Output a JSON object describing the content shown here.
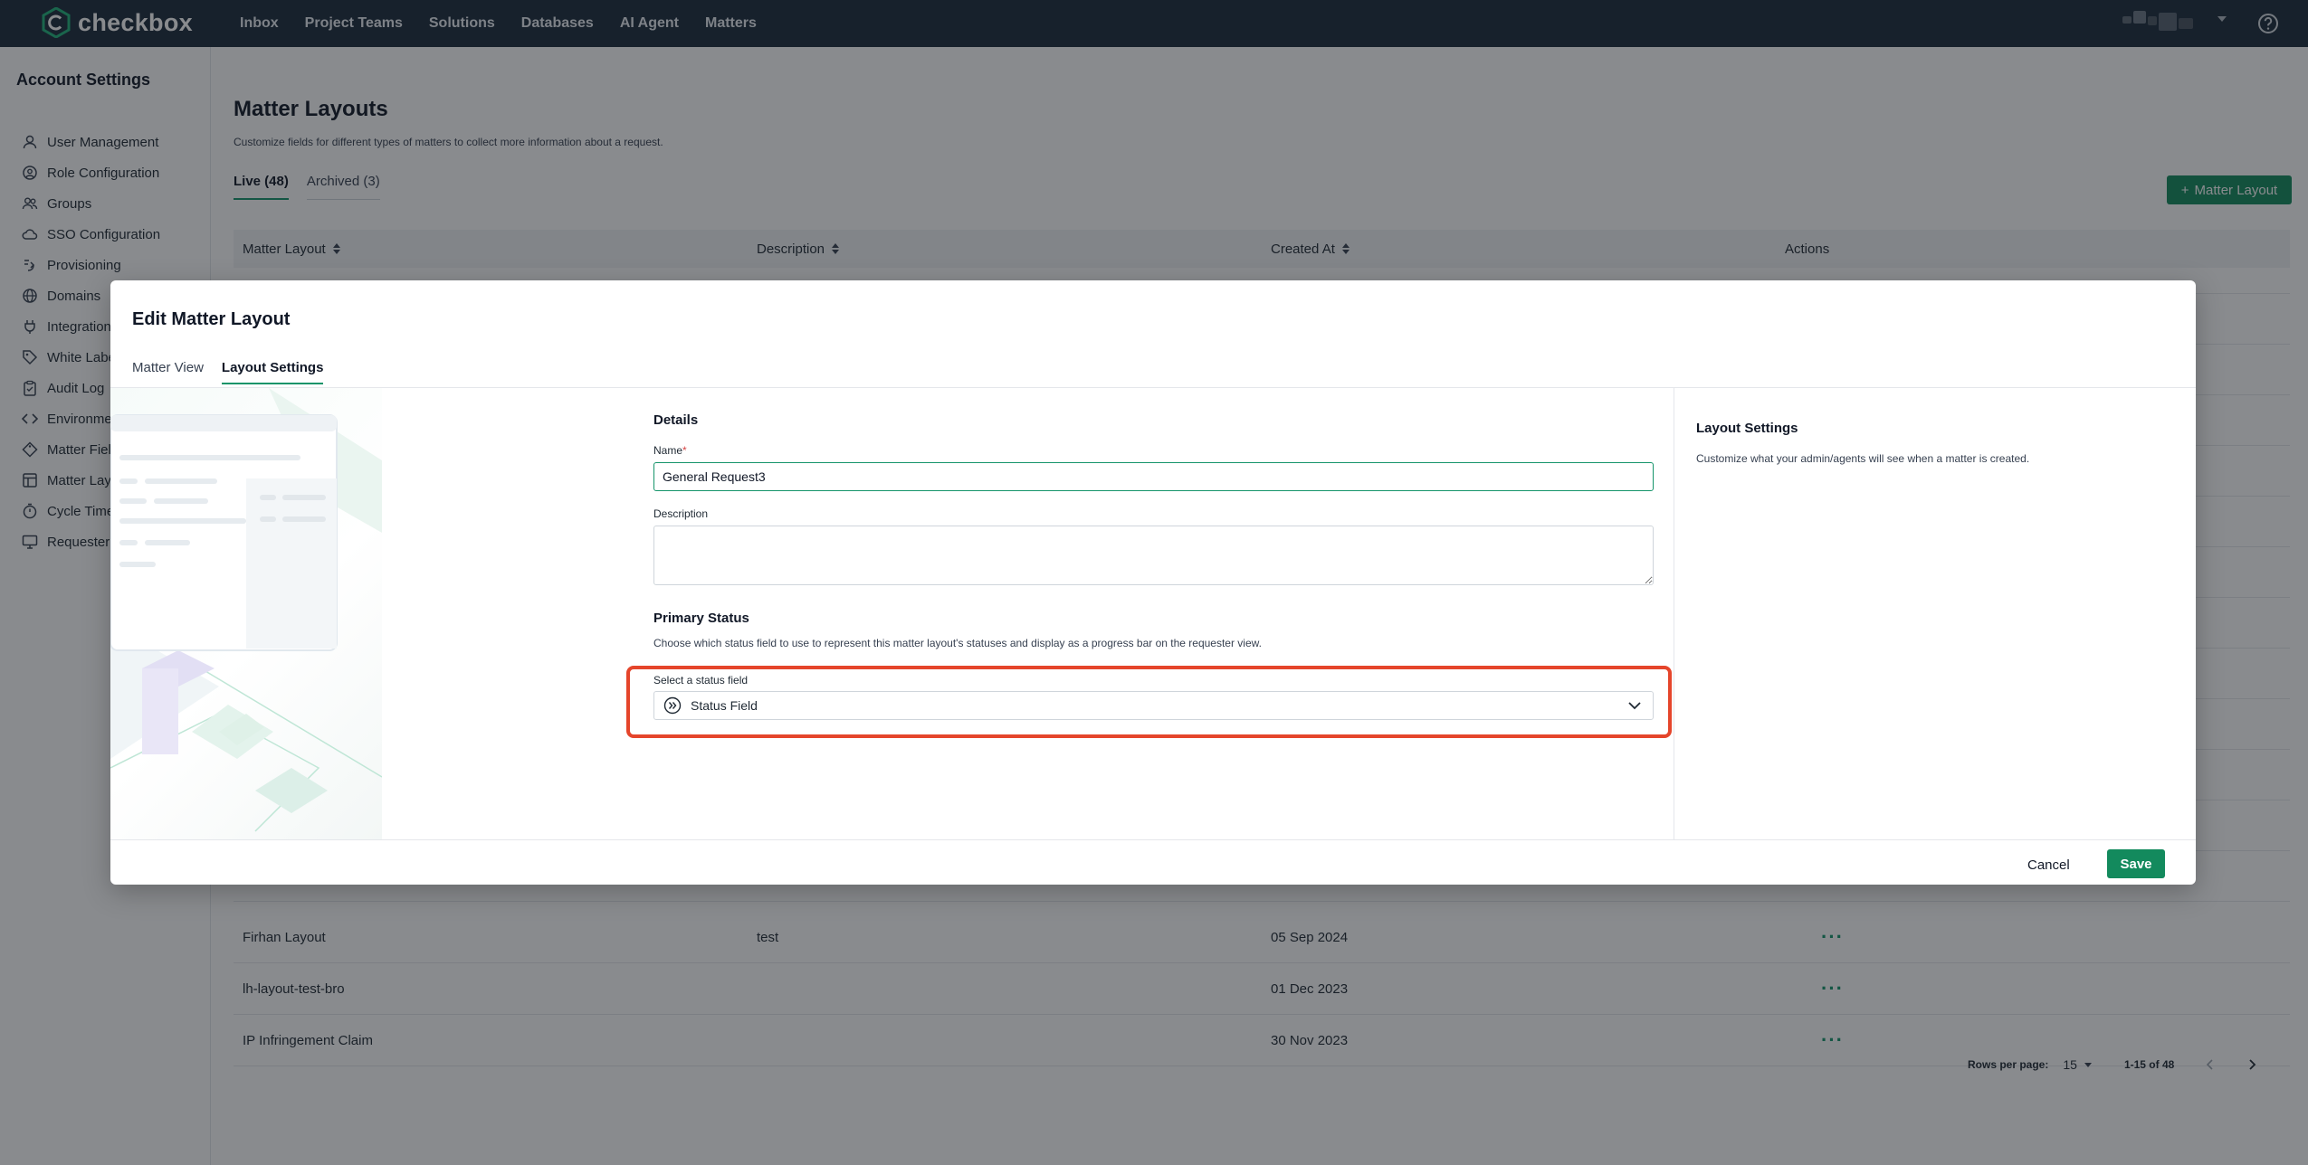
{
  "brand": {
    "name": "checkbox",
    "accent": "#138a5d",
    "nav_bg": "#1b2b3b"
  },
  "topnav": {
    "items": [
      "Inbox",
      "Project Teams",
      "Solutions",
      "Databases",
      "AI Agent",
      "Matters"
    ]
  },
  "sidebar": {
    "title": "Account Settings",
    "items": [
      {
        "label": "User Management",
        "icon": "user-icon"
      },
      {
        "label": "Role Configuration",
        "icon": "role-settings-icon"
      },
      {
        "label": "Groups",
        "icon": "groups-icon"
      },
      {
        "label": "SSO Configuration",
        "icon": "cloud-icon"
      },
      {
        "label": "Provisioning",
        "icon": "provisioning-icon"
      },
      {
        "label": "Domains",
        "icon": "globe-icon"
      },
      {
        "label": "Integration",
        "icon": "plug-icon"
      },
      {
        "label": "White Labe",
        "icon": "tag-icon"
      },
      {
        "label": "Audit Log",
        "icon": "clipboard-icon"
      },
      {
        "label": "Environme",
        "icon": "code-icon"
      },
      {
        "label": "Matter Fiel",
        "icon": "diamond-tag-icon"
      },
      {
        "label": "Matter Layo",
        "icon": "layout-icon"
      },
      {
        "label": "Cycle Time",
        "icon": "timer-icon"
      },
      {
        "label": "Requester",
        "icon": "monitor-icon"
      }
    ]
  },
  "page": {
    "title": "Matter Layouts",
    "subtitle": "Customize fields for different types of matters to collect more information about a request.",
    "tabs": [
      {
        "label": "Live (48)",
        "active": true
      },
      {
        "label": "Archived (3)",
        "active": false
      }
    ],
    "add_button": "Matter Layout",
    "table": {
      "columns": [
        "Matter Layout",
        "Description",
        "Created At",
        "Actions"
      ],
      "rows": [
        {
          "name": "Firhan Layout",
          "description": "test",
          "created": "05 Sep 2024",
          "actions": "···"
        },
        {
          "name": "lh-layout-test-bro",
          "description": "",
          "created": "01 Dec 2023",
          "actions": "···"
        },
        {
          "name": "IP Infringement Claim",
          "description": "",
          "created": "30 Nov 2023",
          "actions": "···"
        }
      ]
    },
    "pager": {
      "rows_label": "Rows per page:",
      "rows_value": "15",
      "range": "1-15 of 48"
    }
  },
  "modal": {
    "title": "Edit Matter Layout",
    "tabs": [
      {
        "label": "Matter View",
        "active": false
      },
      {
        "label": "Layout Settings",
        "active": true
      }
    ],
    "details": {
      "section_title": "Details",
      "name_label": "Name",
      "name_required": "*",
      "name_value": "General Request3",
      "description_label": "Description",
      "description_value": ""
    },
    "primary_status": {
      "section_title": "Primary Status",
      "helper": "Choose which status field to use to represent this matter layout's statuses and display as a progress bar on the requester view.",
      "select_label": "Select a status field",
      "select_value": "Status Field"
    },
    "side": {
      "title": "Layout Settings",
      "subtitle": "Customize what your admin/agents will see when a matter is created."
    },
    "footer": {
      "cancel": "Cancel",
      "save": "Save"
    },
    "highlight_color": "#e5452b"
  }
}
